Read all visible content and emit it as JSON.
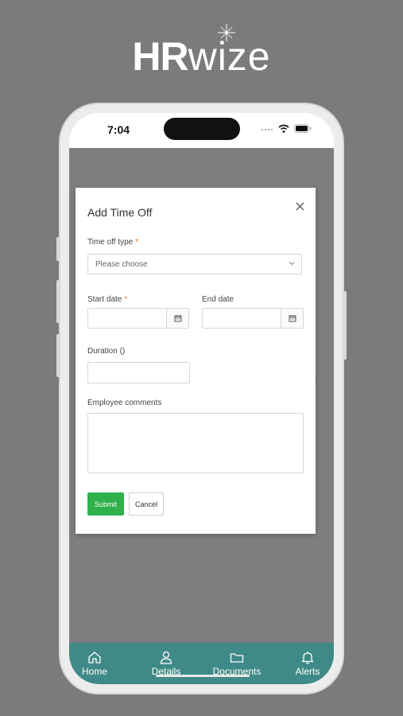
{
  "branding": {
    "logo_hr": "HR",
    "logo_wize": "wize"
  },
  "status_bar": {
    "time": "7:04"
  },
  "modal": {
    "title": "Add Time Off",
    "time_off_type": {
      "label": "Time off type",
      "required_mark": "*",
      "placeholder": "Please choose"
    },
    "start_date": {
      "label": "Start date",
      "required_mark": "*"
    },
    "end_date": {
      "label": "End date"
    },
    "duration": {
      "label": "Duration ()"
    },
    "comments": {
      "label": "Employee comments"
    },
    "submit_label": "Submit",
    "cancel_label": "Cancel"
  },
  "tab_bar": {
    "items": [
      {
        "label": "Home",
        "icon": "home-icon"
      },
      {
        "label": "Details",
        "icon": "person-icon"
      },
      {
        "label": "Documents",
        "icon": "folder-icon"
      },
      {
        "label": "Alerts",
        "icon": "bell-icon"
      }
    ]
  },
  "colors": {
    "accent": "#2fb04a",
    "tab_bar": "#3f8a86",
    "required": "#e07b1f"
  }
}
